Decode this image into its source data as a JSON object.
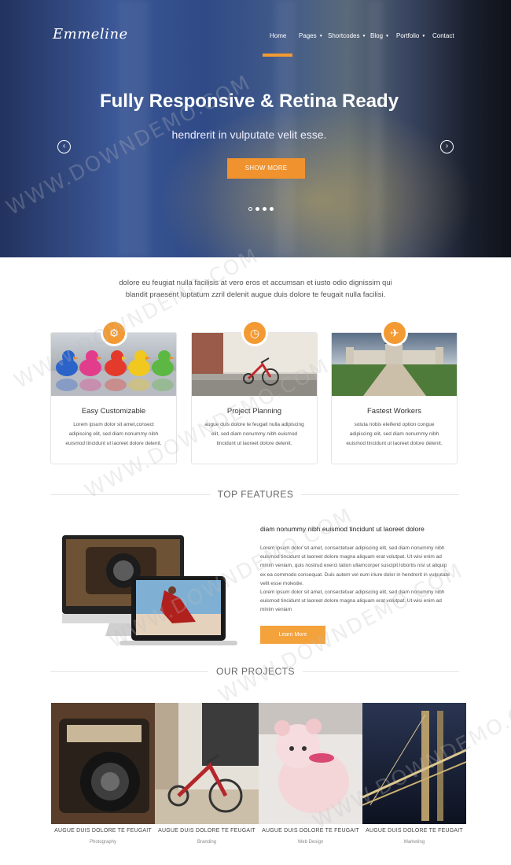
{
  "brand": {
    "logo": "Emmeline"
  },
  "nav": {
    "items": [
      {
        "label": "Home",
        "has_caret": false
      },
      {
        "label": "Pages",
        "has_caret": true
      },
      {
        "label": "Shortcodes",
        "has_caret": true
      },
      {
        "label": "Blog",
        "has_caret": true
      },
      {
        "label": "Portfolio",
        "has_caret": true
      },
      {
        "label": "Contact",
        "has_caret": false
      }
    ],
    "active": "Home"
  },
  "hero": {
    "title": "Fully Responsive & Retina Ready",
    "subtitle": "hendrerit in vulputate velit esse.",
    "button": "SHOW MORE",
    "prev_icon": "chevron-left-icon",
    "next_icon": "chevron-right-icon",
    "slide_count": 4,
    "active_slide": 1
  },
  "intro": {
    "line1": "dolore eu feugiat nulla facilisis at vero eros et accumsan et iusto odio dignissim qui",
    "line2": "blandit praesent luptatum zzril delenit augue duis dolore te feugait nulla facilisi."
  },
  "services": [
    {
      "icon": "gears-icon",
      "title": "Easy Customizable",
      "text": "Lorem ipsum dolor sit amet,consect adipiscing elit, sed diam nonummy nibh euismod tincidunt ut laoreet dolore delenit."
    },
    {
      "icon": "clock-icon",
      "title": "Project Planning",
      "text": "augue duis dolore te feugait nulla adipiscing elit, sed diam nonummy nibh euismod tincidunt ut laoreet dolore delenit."
    },
    {
      "icon": "airplane-icon",
      "title": "Fastest Workers",
      "text": "soluta nobis eleifend option congue adipiscing elit, sed diam nonummy nibh euismod tincidunt ut laoreet dolore delenit."
    }
  ],
  "features": {
    "section_title": "TOP FEATURES",
    "heading": "diam nonummy nibh euismod tincidunt ut laoreet dolore",
    "paragraph": "Lorem ipsum dolor sit amet, consectetuer adipiscing elit, sed diam nonummy nibh euismod tincidunt ut laoreet dolore magna aliquam erat volutpat. Ut wisi enim ad minim veniam, quis nostrud exerci tation ullamcorper suscipit lobortis nisl ut aliquip ex ea commodo consequat. Duis autem vel eum iriure dolor in hendrerit in vulputate velit esse molestie.",
    "paragraph2": "Lorem ipsum dolor sit amet, consectetuer adipiscing elit, sed diam nonummy nibh euismod tincidunt ut laoreet dolore magna aliquam erat volutpat. Ut wisi enim ad minim veniam",
    "button": "Learn More"
  },
  "projects": {
    "section_title": "OUR PROJECTS",
    "items": [
      {
        "title": "AUGUE DUIS DOLORE TE FEUGAIT",
        "category": "Photography"
      },
      {
        "title": "AUGUE DUIS DOLORE TE FEUGAIT",
        "category": "Branding"
      },
      {
        "title": "AUGUE DUIS DOLORE TE FEUGAIT",
        "category": "Web Design"
      },
      {
        "title": "AUGUE DUIS DOLORE TE FEUGAIT",
        "category": "Marketing"
      }
    ]
  },
  "watermark": "WWW.DOWNDEMO.COM",
  "colors": {
    "accent": "#f39a33",
    "hero_blue": "#2f4a86",
    "text": "#444444"
  }
}
